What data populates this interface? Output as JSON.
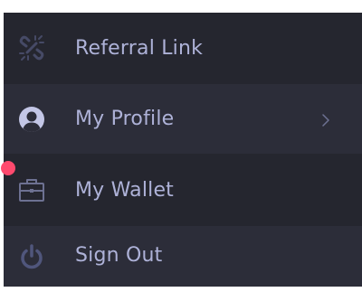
{
  "menu": {
    "items": [
      {
        "label": "Referral Link",
        "icon": "broken-link-icon"
      },
      {
        "label": "My Profile",
        "icon": "user-circle-icon",
        "has_chevron": true
      },
      {
        "label": "My Wallet",
        "icon": "briefcase-icon",
        "has_notification": true
      },
      {
        "label": "Sign Out",
        "icon": "power-icon"
      }
    ]
  },
  "colors": {
    "background": "#25262f",
    "alternate_row": "#2c2d39",
    "text": "#aeb2d8",
    "icon": "#6d7192",
    "icon_active": "#c3c6e6",
    "notification": "#ff4a6e"
  }
}
